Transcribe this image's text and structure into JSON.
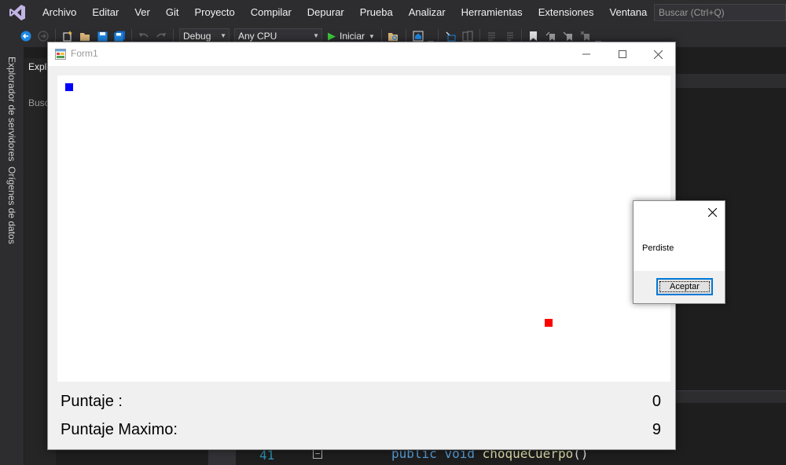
{
  "vs": {
    "menu": [
      "Archivo",
      "Editar",
      "Ver",
      "Git",
      "Proyecto",
      "Compilar",
      "Depurar",
      "Prueba",
      "Analizar",
      "Herramientas",
      "Extensiones",
      "Ventana",
      "Ayuda"
    ],
    "search_placeholder": "Buscar (Ctrl+Q)",
    "config": "Debug",
    "platform": "Any CPU",
    "start_label": "Iniciar",
    "side_tabs": [
      "Explorador de servidores",
      "Orígenes de datos"
    ],
    "explorer_title": "Explo",
    "explorer_search": "Busca",
    "code": {
      "line_number": "41",
      "keyword_1": "public",
      "keyword_2": "void",
      "method": "choqueCuerpo",
      "parens": "()"
    }
  },
  "form": {
    "title": "Form1",
    "score_label": "Puntaje :",
    "score_value": "0",
    "max_label": "Puntaje Maximo:",
    "max_value": "9",
    "colors": {
      "snake": "#0000ff",
      "food": "#ff0000"
    }
  },
  "message": {
    "text": "Perdiste",
    "ok_label": "Aceptar"
  }
}
